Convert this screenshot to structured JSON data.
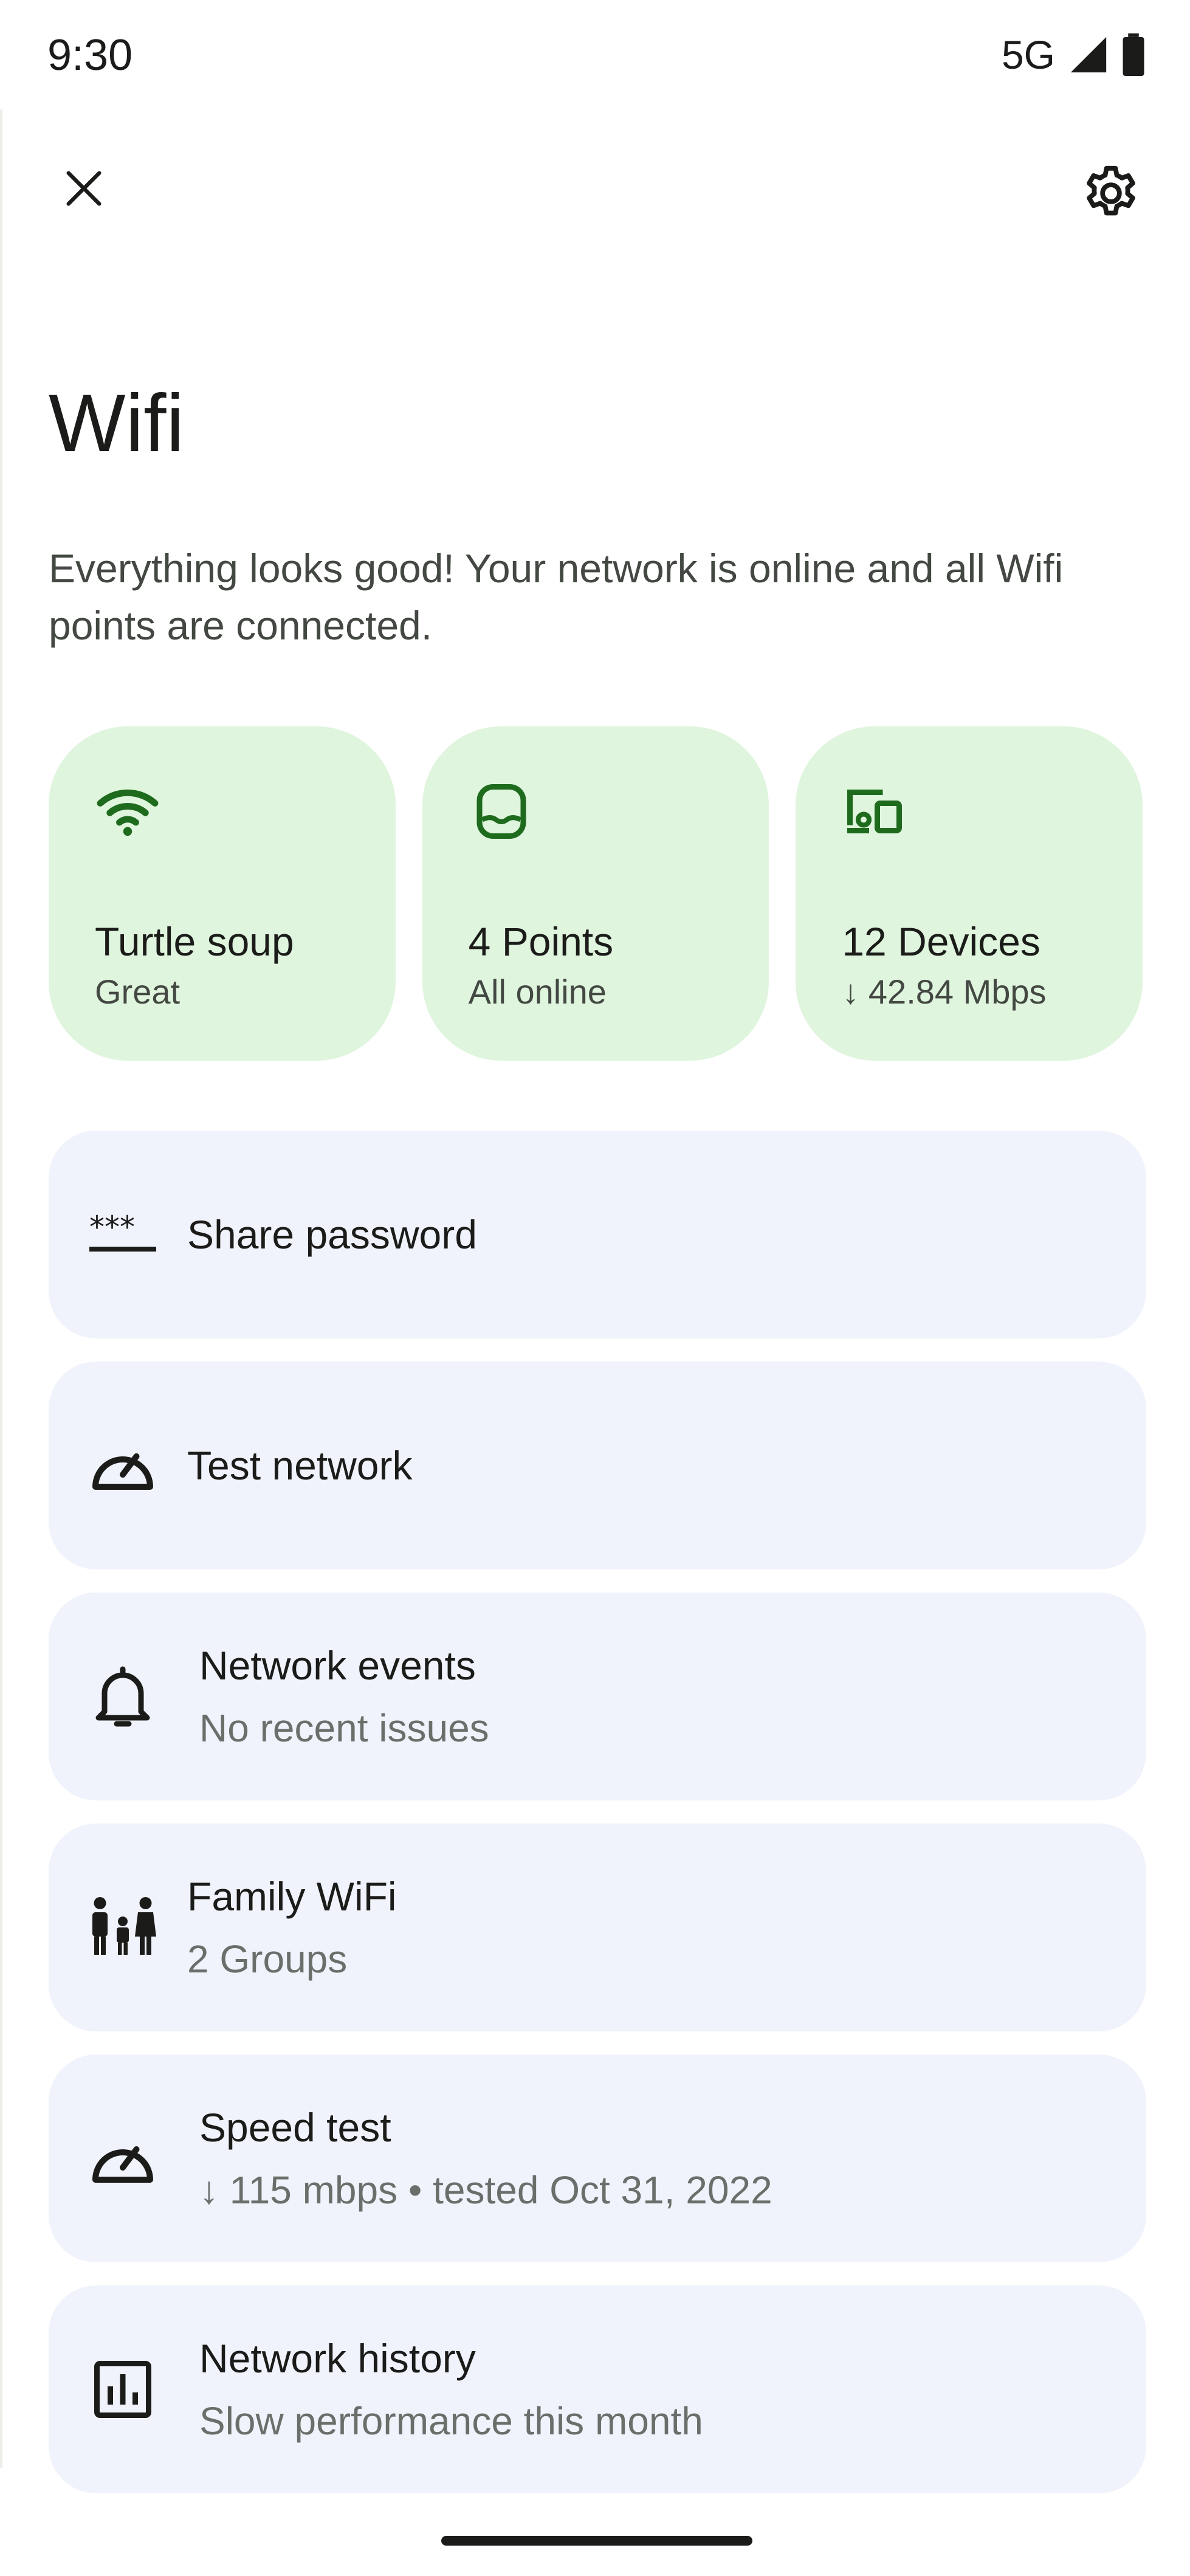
{
  "status_bar": {
    "time": "9:30",
    "network": "5G"
  },
  "app_bar": {
    "close_icon": "close-icon",
    "settings_icon": "gear-icon"
  },
  "header": {
    "title": "Wifi",
    "description": "Everything looks good! Your network is online and all Wifi points are connected."
  },
  "tiles": [
    {
      "title": "Turtle soup",
      "subtitle": "Great",
      "icon": "wifi-icon"
    },
    {
      "title": "4 Points",
      "subtitle": "All online",
      "icon": "wifi-point-icon"
    },
    {
      "title": "12 Devices",
      "subtitle": "↓ 42.84 Mbps",
      "icon": "devices-icon"
    }
  ],
  "cards": [
    {
      "title": "Share password",
      "subtitle": "",
      "icon": "password-icon"
    },
    {
      "title": "Test network",
      "subtitle": "",
      "icon": "speedometer-icon"
    },
    {
      "title": "Network events",
      "subtitle": "No recent issues",
      "icon": "bell-icon"
    },
    {
      "title": "Family WiFi",
      "subtitle": "2 Groups",
      "icon": "family-icon"
    },
    {
      "title": "Speed test",
      "subtitle": "↓ 115 mbps • tested Oct 31, 2022",
      "icon": "speedometer-icon"
    },
    {
      "title": "Network history",
      "subtitle": "Slow performance this month",
      "icon": "bar-chart-icon"
    }
  ],
  "colors": {
    "tile_bg": "#dff5dd",
    "tile_icon": "#1e6b1e",
    "card_bg": "#f0f3fb",
    "text_primary": "#1b1c1a",
    "text_secondary": "#6b6f6b"
  }
}
